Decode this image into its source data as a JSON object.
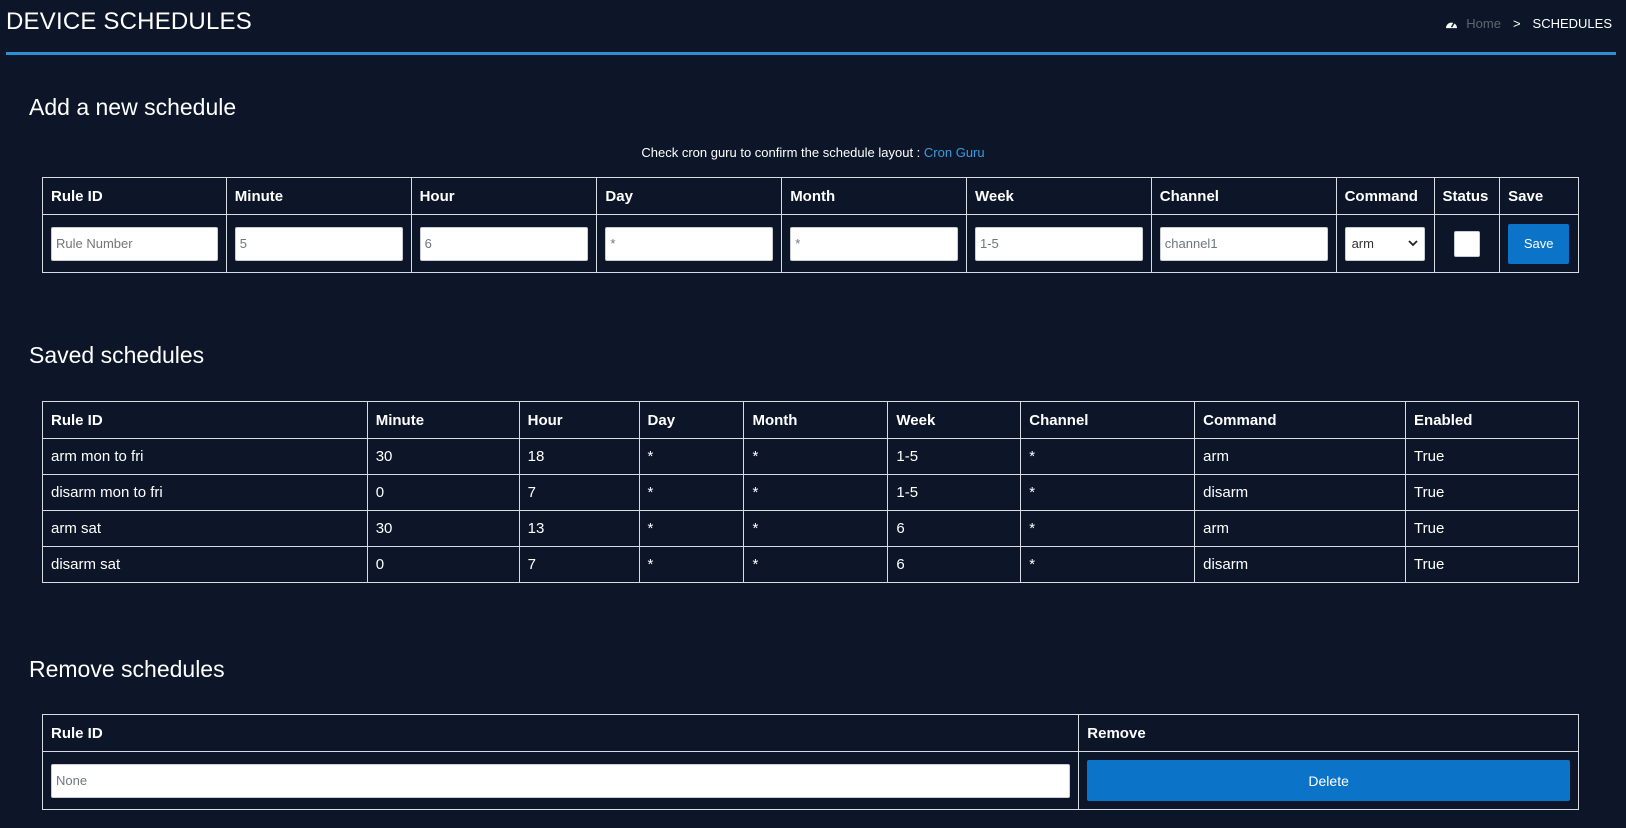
{
  "header": {
    "title": "DEVICE SCHEDULES",
    "breadcrumb": {
      "home": "Home",
      "separator": ">",
      "current": "SCHEDULES"
    }
  },
  "add_section": {
    "title": "Add a new schedule",
    "hint_text": "Check cron guru to confirm the schedule layout :",
    "hint_link": "Cron Guru",
    "columns": [
      "Rule ID",
      "Minute",
      "Hour",
      "Day",
      "Month",
      "Week",
      "Channel",
      "Command",
      "Status",
      "Save"
    ],
    "inputs": {
      "rule_id_placeholder": "Rule Number",
      "minute": "5",
      "hour": "6",
      "day": "*",
      "month": "*",
      "week": "1-5",
      "channel": "channel1",
      "command": "arm"
    },
    "save_label": "Save"
  },
  "saved_section": {
    "title": "Saved schedules",
    "columns": [
      "Rule ID",
      "Minute",
      "Hour",
      "Day",
      "Month",
      "Week",
      "Channel",
      "Command",
      "Enabled"
    ],
    "rows": [
      [
        "arm mon to fri",
        "30",
        "18",
        "*",
        "*",
        "1-5",
        "*",
        "arm",
        "True"
      ],
      [
        "disarm mon to fri",
        "0",
        "7",
        "*",
        "*",
        "1-5",
        "*",
        "disarm",
        "True"
      ],
      [
        "arm sat",
        "30",
        "13",
        "*",
        "*",
        "6",
        "*",
        "arm",
        "True"
      ],
      [
        "disarm sat",
        "0",
        "7",
        "*",
        "*",
        "6",
        "*",
        "disarm",
        "True"
      ]
    ]
  },
  "remove_section": {
    "title": "Remove schedules",
    "columns": [
      "Rule ID",
      "Remove"
    ],
    "rule_id_value": "None",
    "delete_label": "Delete"
  },
  "colors": {
    "background": "#0c1628",
    "accent": "#2f8fd6",
    "button": "#0b74c8",
    "link": "#3a9be0"
  }
}
